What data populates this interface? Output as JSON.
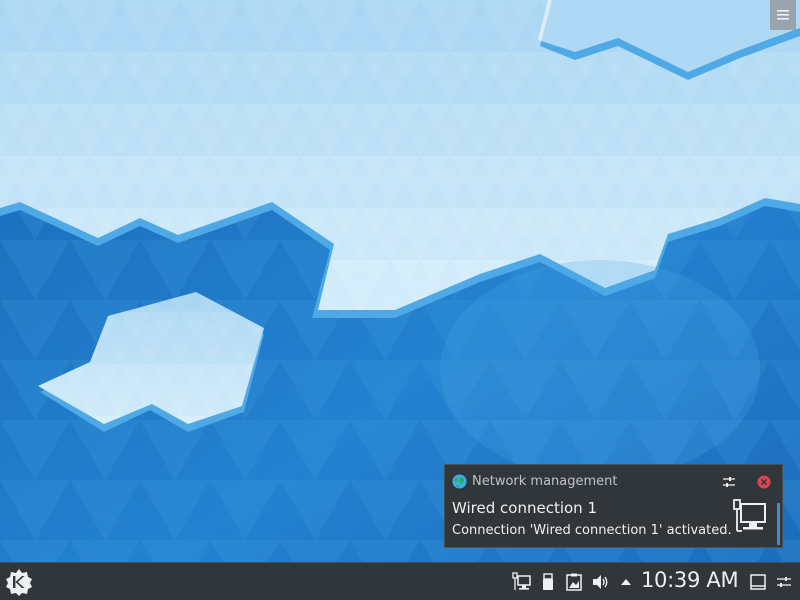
{
  "desktop": {
    "toolbox_icon": "hamburger-menu-icon"
  },
  "notification": {
    "app_icon": "globe-icon",
    "app_name": "Network management",
    "config_icon": "configure-sliders-icon",
    "close_icon": "close-icon",
    "title": "Wired connection 1",
    "body": "Connection 'Wired connection 1' activated.",
    "image_icon": "wired-network-icon"
  },
  "panel": {
    "launcher_icon": "kde-logo-icon",
    "tray": [
      {
        "name": "network-wired-icon"
      },
      {
        "name": "usb-device-icon"
      },
      {
        "name": "clipboard-icon"
      },
      {
        "name": "volume-icon"
      },
      {
        "name": "tray-expand-arrow-icon"
      }
    ],
    "clock": "10:39 AM",
    "show_desktop_icon": "show-desktop-icon",
    "panel_config_icon": "panel-settings-icon"
  },
  "colors": {
    "panel_bg": "#31363b",
    "text": "#eff0f1",
    "accent": "#3daee9",
    "close_red": "#da4453"
  }
}
